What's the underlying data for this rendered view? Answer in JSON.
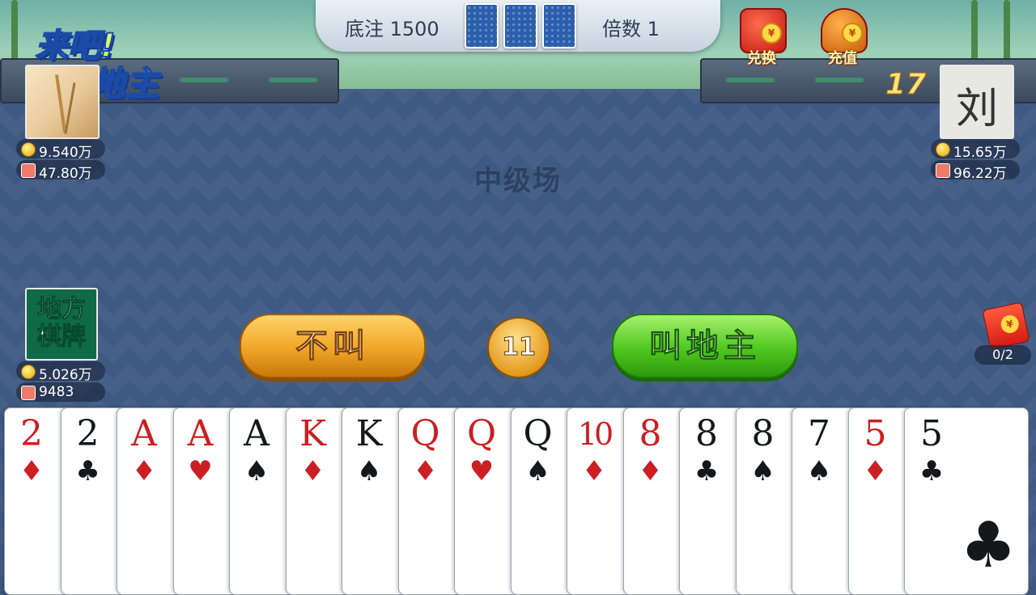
{
  "header": {
    "base_bet_label": "底注 1500",
    "multiplier_label": "倍数 1"
  },
  "logo": {
    "line1": "来吧!",
    "line2": "斗地主"
  },
  "shop": {
    "exchange_label": "兑换",
    "recharge_label": "充值"
  },
  "venue_label": "中级场",
  "players": {
    "left": {
      "gold": "9.540万",
      "gift": "47.80万"
    },
    "right": {
      "avatar_char": "刘",
      "gold": "15.65万",
      "gift": "96.22万",
      "countdown": "17"
    },
    "local": {
      "avatar_text": "地方棋牌",
      "gold": "5.026万",
      "gift": "9483"
    }
  },
  "actions": {
    "pass_label": "不叫",
    "call_label": "叫地主",
    "timer": "11"
  },
  "red_packet": {
    "progress": "0/2"
  },
  "hand": [
    {
      "rank": "2",
      "suit": "♦",
      "color": "red"
    },
    {
      "rank": "2",
      "suit": "♣",
      "color": "black"
    },
    {
      "rank": "A",
      "suit": "♦",
      "color": "red"
    },
    {
      "rank": "A",
      "suit": "♥",
      "color": "red"
    },
    {
      "rank": "A",
      "suit": "♠",
      "color": "black"
    },
    {
      "rank": "K",
      "suit": "♦",
      "color": "red"
    },
    {
      "rank": "K",
      "suit": "♠",
      "color": "black"
    },
    {
      "rank": "Q",
      "suit": "♦",
      "color": "red"
    },
    {
      "rank": "Q",
      "suit": "♥",
      "color": "red"
    },
    {
      "rank": "Q",
      "suit": "♠",
      "color": "black"
    },
    {
      "rank": "10",
      "suit": "♦",
      "color": "red"
    },
    {
      "rank": "8",
      "suit": "♦",
      "color": "red"
    },
    {
      "rank": "8",
      "suit": "♣",
      "color": "black"
    },
    {
      "rank": "8",
      "suit": "♠",
      "color": "black"
    },
    {
      "rank": "7",
      "suit": "♠",
      "color": "black"
    },
    {
      "rank": "5",
      "suit": "♦",
      "color": "red"
    },
    {
      "rank": "5",
      "suit": "♣",
      "color": "black"
    }
  ],
  "colors": {
    "red_suit": "#cc1f23",
    "black_suit": "#15171b",
    "table": "#3f5a82"
  }
}
